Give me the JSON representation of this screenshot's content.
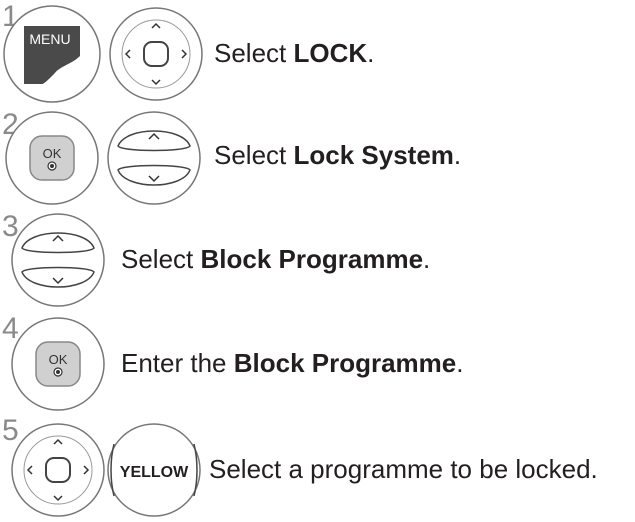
{
  "steps": [
    {
      "number": "1",
      "text_pre": "Select ",
      "text_bold": "LOCK",
      "text_post": ".",
      "buttons": [
        "MENU",
        "navigation"
      ]
    },
    {
      "number": "2",
      "text_pre": "Select ",
      "text_bold": "Lock System",
      "text_post": ".",
      "buttons": [
        "OK",
        "up-down"
      ]
    },
    {
      "number": "3",
      "text_pre": "Select ",
      "text_bold": "Block Programme",
      "text_post": ".",
      "buttons": [
        "up-down"
      ]
    },
    {
      "number": "4",
      "text_pre": "Enter the ",
      "text_bold": "Block Programme",
      "text_post": ".",
      "buttons": [
        "OK"
      ]
    },
    {
      "number": "5",
      "text_pre": "Select a programme to be locked.",
      "text_bold": "",
      "text_post": "",
      "buttons": [
        "navigation",
        "YELLOW"
      ]
    }
  ],
  "labels": {
    "menu": "MENU",
    "ok": "OK",
    "yellow": "YELLOW"
  }
}
